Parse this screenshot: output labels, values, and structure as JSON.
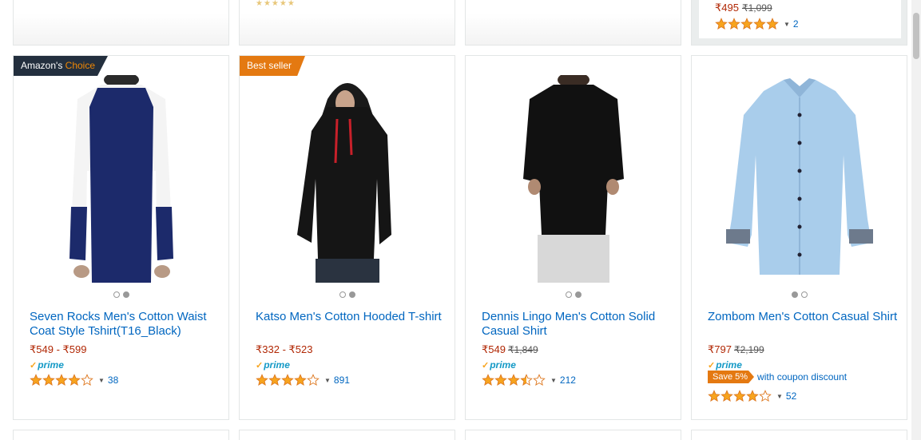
{
  "top_row": {
    "card4": {
      "price": "₹495",
      "was": "₹1,099",
      "rating": 5,
      "count": "2"
    }
  },
  "products": [
    {
      "badge": {
        "type": "choice",
        "prefix": "Amazon's",
        "em": "Choice"
      },
      "title": "Seven Rocks Men's Cotton Waist Coat Style Tshirt(T16_Black)",
      "price": "₹549 - ₹599",
      "was": "",
      "prime": "prime",
      "rating": 4,
      "count": "38",
      "dots": [
        false,
        true
      ]
    },
    {
      "badge": {
        "type": "seller",
        "label": "Best seller"
      },
      "title": "Katso Men's Cotton Hooded T-shirt",
      "price": "₹332 - ₹523",
      "was": "",
      "prime": "prime",
      "rating": 4,
      "count": "891",
      "dots": [
        false,
        true
      ]
    },
    {
      "title": "Dennis Lingo Men's Cotton Solid Casual Shirt",
      "price": "₹549",
      "was": "₹1,849",
      "prime": "prime",
      "rating": 3.5,
      "count": "212",
      "dots": [
        false,
        true
      ]
    },
    {
      "title": "Zombom Men's Cotton Casual Shirt",
      "price": "₹797",
      "was": "₹2,199",
      "prime": "prime",
      "save": {
        "tag": "Save 5%",
        "text": "with coupon discount"
      },
      "rating": 4,
      "count": "52",
      "dots": [
        true,
        false
      ]
    }
  ],
  "colors": {
    "accent": "#e47911",
    "link": "#0066c0",
    "price": "#b12704",
    "star": "#f7a41d"
  }
}
